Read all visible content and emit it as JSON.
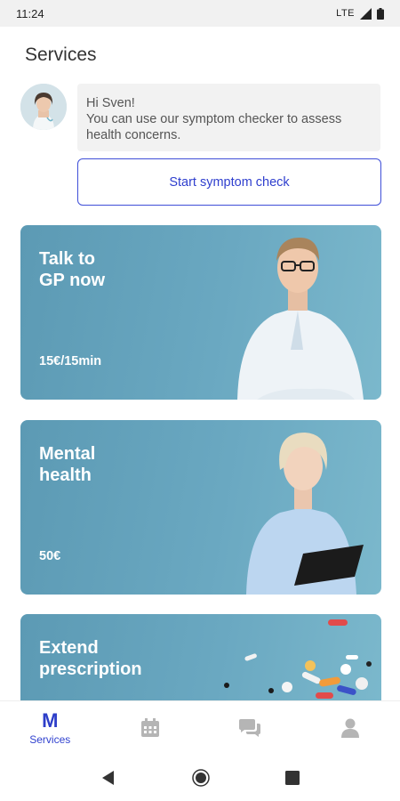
{
  "status_bar": {
    "time": "11:24",
    "network": "LTE"
  },
  "page": {
    "title": "Services"
  },
  "assistant": {
    "message": "Hi Sven!\nYou can use our symptom checker to assess health concerns.",
    "button_label": "Start symptom check"
  },
  "cards": [
    {
      "title": "Talk to\nGP now",
      "price": "15€/15min",
      "image": "doctor-photo"
    },
    {
      "title": "Mental\nhealth",
      "price": "50€",
      "image": "therapist-photo"
    },
    {
      "title": "Extend\nprescription",
      "image": "pills-photo"
    }
  ],
  "bottom_nav": {
    "items": [
      {
        "label": "Services",
        "icon": "m-logo-icon",
        "active": true
      },
      {
        "label": "",
        "icon": "calendar-icon"
      },
      {
        "label": "",
        "icon": "chat-icon"
      },
      {
        "label": "",
        "icon": "person-icon"
      }
    ]
  },
  "colors": {
    "accent": "#3142cf",
    "card": "#6aa8c1"
  }
}
